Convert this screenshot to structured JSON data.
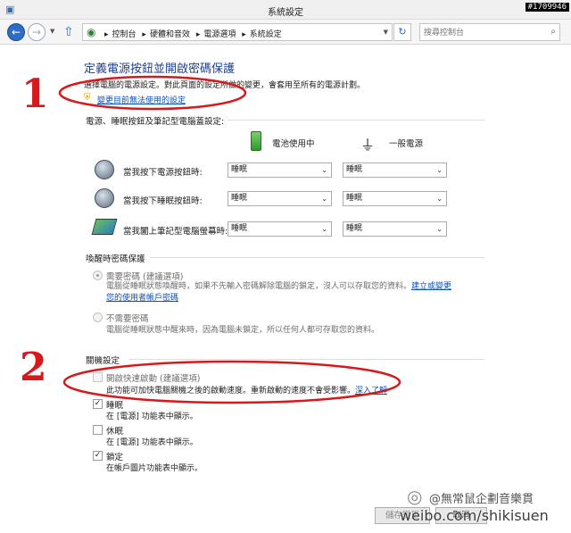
{
  "window": {
    "title": "系統設定",
    "watermark_id": "#1709946"
  },
  "nav": {
    "breadcrumbs": [
      "控制台",
      "硬體和音效",
      "電源選項",
      "系統設定"
    ],
    "search_placeholder": "搜尋控制台"
  },
  "page": {
    "title": "定義電源按鈕並開啟密碼保護",
    "description": "選擇電腦的電源設定。對此頁面的設定所做的變更，會套用至所有的電源計劃。",
    "change_settings_link": "變更目前無法使用的設定"
  },
  "power_section": {
    "title": "電源、睡眠按鈕及筆記型電腦蓋設定:",
    "col_battery": "電池使用中",
    "col_ac": "一般電源",
    "rows": [
      {
        "label": "當我按下電源按鈕時:",
        "battery": "睡眠",
        "ac": "睡眠"
      },
      {
        "label": "當我按下睡眠按鈕時:",
        "battery": "睡眠",
        "ac": "睡眠"
      },
      {
        "label": "當我闔上筆記型電腦螢幕時:",
        "battery": "睡眠",
        "ac": "睡眠"
      }
    ]
  },
  "password_section": {
    "title": "喚醒時密碼保護",
    "require": {
      "label": "需要密碼 (建議選項)",
      "desc": "電腦從睡眠狀態喚醒時，如果不先輸入密碼解除電腦的鎖定，沒人可以存取您的資料。",
      "link_a": "建立或變更",
      "link_b": "您的使用者帳戶密碼"
    },
    "no_require": {
      "label": "不需要密碼",
      "desc": "電腦從睡眠狀態中醒來時，因為電腦未鎖定，所以任何人都可存取您的資料。"
    }
  },
  "shutdown_section": {
    "title": "關機設定",
    "fast_startup": {
      "label": "開啟快速啟動 (建議選項)",
      "desc": "此功能可加快電腦關機之後的啟動速度。重新啟動的速度不會受影響。",
      "link": "深入了解"
    },
    "sleep": {
      "label": "睡眠",
      "desc": "在 [電源] 功能表中顯示。",
      "checked": true
    },
    "hibernate": {
      "label": "休眠",
      "desc": "在 [電源] 功能表中顯示。",
      "checked": false
    },
    "lock": {
      "label": "鎖定",
      "desc": "在帳戶圖片功能表中顯示。",
      "checked": true
    }
  },
  "buttons": {
    "save": "儲存變更",
    "cancel": "取消"
  },
  "annotations": {
    "one": "1",
    "two": "2"
  },
  "weibo": {
    "handle": "@無常鼠企劃音樂貫",
    "url": "weibo.com/shikisuen"
  },
  "colors": {
    "annotation_red": "#d7191c",
    "heading_blue": "#1e3f8c",
    "link_blue": "#0a51b8"
  }
}
